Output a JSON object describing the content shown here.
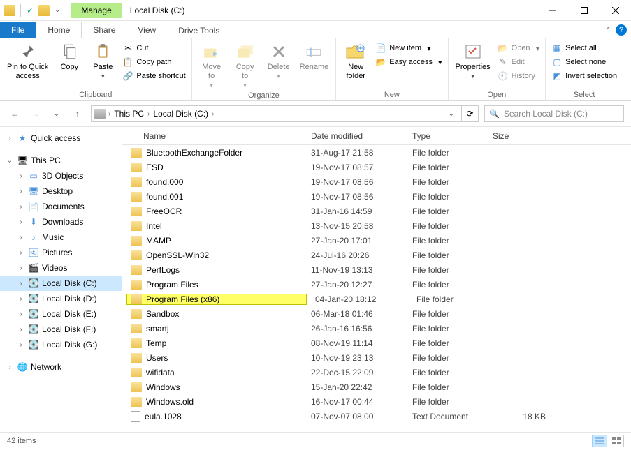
{
  "title": "Local Disk (C:)",
  "manage_label": "Manage",
  "tabs": {
    "file": "File",
    "home": "Home",
    "share": "Share",
    "view": "View",
    "drive_tools": "Drive Tools"
  },
  "ribbon": {
    "clipboard": {
      "label": "Clipboard",
      "pin": "Pin to Quick\naccess",
      "copy": "Copy",
      "paste": "Paste",
      "cut": "Cut",
      "copy_path": "Copy path",
      "paste_shortcut": "Paste shortcut"
    },
    "organize": {
      "label": "Organize",
      "move_to": "Move\nto",
      "copy_to": "Copy\nto",
      "delete": "Delete",
      "rename": "Rename"
    },
    "new": {
      "label": "New",
      "new_folder": "New\nfolder",
      "new_item": "New item",
      "easy_access": "Easy access"
    },
    "open": {
      "label": "Open",
      "properties": "Properties",
      "open": "Open",
      "edit": "Edit",
      "history": "History"
    },
    "select": {
      "label": "Select",
      "select_all": "Select all",
      "select_none": "Select none",
      "invert": "Invert selection"
    }
  },
  "breadcrumb": {
    "this_pc": "This PC",
    "drive": "Local Disk (C:)"
  },
  "search_placeholder": "Search Local Disk (C:)",
  "columns": {
    "name": "Name",
    "date": "Date modified",
    "type": "Type",
    "size": "Size"
  },
  "nav": {
    "quick_access": "Quick access",
    "this_pc": "This PC",
    "objects3d": "3D Objects",
    "desktop": "Desktop",
    "documents": "Documents",
    "downloads": "Downloads",
    "music": "Music",
    "pictures": "Pictures",
    "videos": "Videos",
    "drive_c": "Local Disk (C:)",
    "drive_d": "Local Disk (D:)",
    "drive_e": "Local Disk (E:)",
    "drive_f": "Local Disk (F:)",
    "drive_g": "Local Disk (G:)",
    "network": "Network"
  },
  "files": [
    {
      "name": "BluetoothExchangeFolder",
      "date": "31-Aug-17 21:58",
      "type": "File folder",
      "size": "",
      "icon": "folder"
    },
    {
      "name": "ESD",
      "date": "19-Nov-17 08:57",
      "type": "File folder",
      "size": "",
      "icon": "folder"
    },
    {
      "name": "found.000",
      "date": "19-Nov-17 08:56",
      "type": "File folder",
      "size": "",
      "icon": "folder"
    },
    {
      "name": "found.001",
      "date": "19-Nov-17 08:56",
      "type": "File folder",
      "size": "",
      "icon": "folder"
    },
    {
      "name": "FreeOCR",
      "date": "31-Jan-16 14:59",
      "type": "File folder",
      "size": "",
      "icon": "folder"
    },
    {
      "name": "Intel",
      "date": "13-Nov-15 20:58",
      "type": "File folder",
      "size": "",
      "icon": "folder"
    },
    {
      "name": "MAMP",
      "date": "27-Jan-20 17:01",
      "type": "File folder",
      "size": "",
      "icon": "folder"
    },
    {
      "name": "OpenSSL-Win32",
      "date": "24-Jul-16 20:26",
      "type": "File folder",
      "size": "",
      "icon": "folder"
    },
    {
      "name": "PerfLogs",
      "date": "11-Nov-19 13:13",
      "type": "File folder",
      "size": "",
      "icon": "folder"
    },
    {
      "name": "Program Files",
      "date": "27-Jan-20 12:27",
      "type": "File folder",
      "size": "",
      "icon": "folder"
    },
    {
      "name": "Program Files (x86)",
      "date": "04-Jan-20 18:12",
      "type": "File folder",
      "size": "",
      "icon": "folder",
      "highlighted": true
    },
    {
      "name": "Sandbox",
      "date": "06-Mar-18 01:46",
      "type": "File folder",
      "size": "",
      "icon": "folder"
    },
    {
      "name": "smartj",
      "date": "26-Jan-16 16:56",
      "type": "File folder",
      "size": "",
      "icon": "folder"
    },
    {
      "name": "Temp",
      "date": "08-Nov-19 11:14",
      "type": "File folder",
      "size": "",
      "icon": "folder"
    },
    {
      "name": "Users",
      "date": "10-Nov-19 23:13",
      "type": "File folder",
      "size": "",
      "icon": "folder"
    },
    {
      "name": "wifidata",
      "date": "22-Dec-15 22:09",
      "type": "File folder",
      "size": "",
      "icon": "folder"
    },
    {
      "name": "Windows",
      "date": "15-Jan-20 22:42",
      "type": "File folder",
      "size": "",
      "icon": "folder"
    },
    {
      "name": "Windows.old",
      "date": "16-Nov-17 00:44",
      "type": "File folder",
      "size": "",
      "icon": "folder"
    },
    {
      "name": "eula.1028",
      "date": "07-Nov-07 08:00",
      "type": "Text Document",
      "size": "18 KB",
      "icon": "file"
    }
  ],
  "status": {
    "count": "42 items"
  }
}
